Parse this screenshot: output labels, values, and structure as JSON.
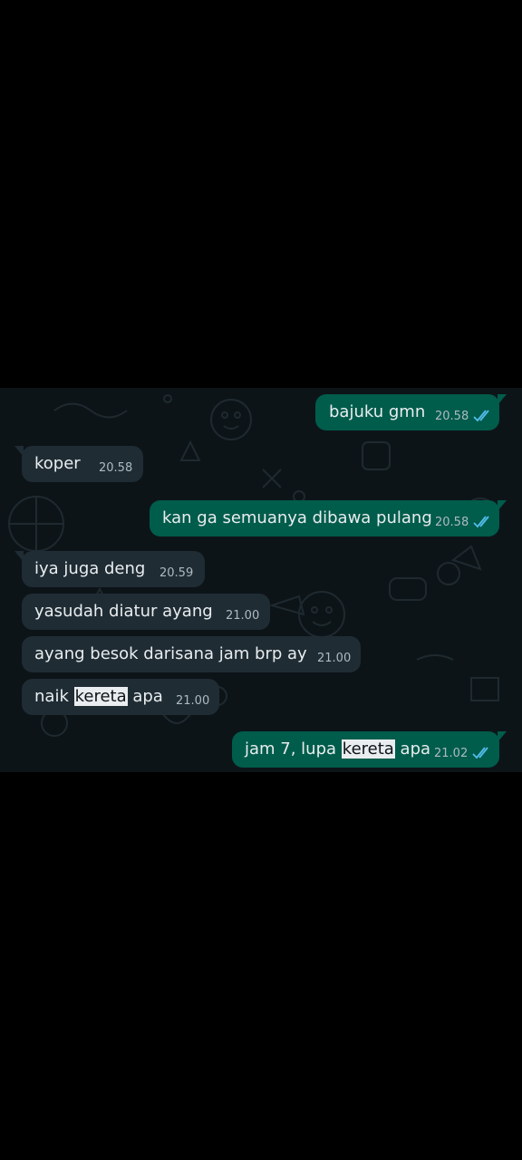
{
  "messages": [
    {
      "id": "m1",
      "direction": "outgoing",
      "text": "bajuku gmn",
      "time": "20.58",
      "status": "read"
    },
    {
      "id": "m2",
      "direction": "incoming",
      "text": "koper",
      "time": "20.58"
    },
    {
      "id": "m3",
      "direction": "outgoing",
      "text": "kan ga semuanya dibawa pulang",
      "time": "20.58",
      "status": "read"
    },
    {
      "id": "m4",
      "direction": "incoming",
      "text": "iya juga deng",
      "time": "20.59"
    },
    {
      "id": "m5",
      "direction": "incoming",
      "text": "yasudah diatur ayang",
      "time": "21.00"
    },
    {
      "id": "m6",
      "direction": "incoming",
      "text": "ayang besok darisana jam brp ay",
      "time": "21.00"
    },
    {
      "id": "m7",
      "direction": "incoming",
      "text_before": "naik ",
      "text_highlight": "kereta",
      "text_after": " apa",
      "time": "21.00"
    },
    {
      "id": "m8",
      "direction": "outgoing",
      "text_before": "jam 7, lupa ",
      "text_highlight": "kereta",
      "text_after": " apa",
      "time": "21.02",
      "status": "read"
    }
  ],
  "colors": {
    "chat_background": "#0d1418",
    "outgoing_bubble": "#005c4b",
    "incoming_bubble": "#1f2c34",
    "read_ticks": "#53bdeb",
    "highlight": "#e9edef"
  },
  "icons": {
    "read_status": "double-check-icon"
  }
}
